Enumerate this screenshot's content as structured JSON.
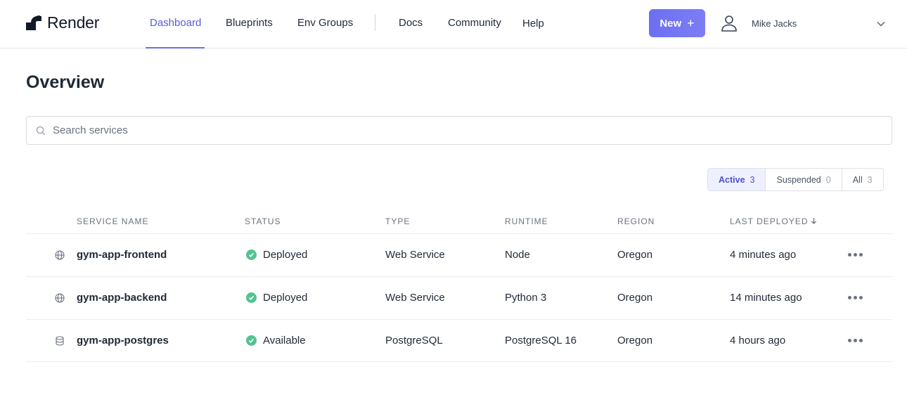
{
  "header": {
    "brand": "Render",
    "nav": [
      {
        "label": "Dashboard",
        "active": true
      },
      {
        "label": "Blueprints"
      },
      {
        "label": "Env Groups"
      },
      {
        "label": "Docs"
      },
      {
        "label": "Community"
      },
      {
        "label": "Help"
      }
    ],
    "new_button": "New",
    "new_button_icon": "plus-icon",
    "user_name": "Mike Jacks",
    "accent_color": "#5b5bd6"
  },
  "main": {
    "title": "Overview",
    "search": {
      "placeholder": "Search services",
      "value": ""
    },
    "filters": [
      {
        "label": "Active",
        "count": "3",
        "active": true
      },
      {
        "label": "Suspended",
        "count": "0"
      },
      {
        "label": "All",
        "count": "3"
      }
    ],
    "table": {
      "columns": [
        "SERVICE NAME",
        "STATUS",
        "TYPE",
        "RUNTIME",
        "REGION",
        "LAST DEPLOYED"
      ],
      "sort_icon": "arrow-down-icon",
      "rows": [
        {
          "icon": "globe-icon",
          "name": "gym-app-frontend",
          "status": "Deployed",
          "type": "Web Service",
          "runtime": "Node",
          "region": "Oregon",
          "last_deployed": "4 minutes ago"
        },
        {
          "icon": "globe-icon",
          "name": "gym-app-backend",
          "status": "Deployed",
          "type": "Web Service",
          "runtime": "Python 3",
          "region": "Oregon",
          "last_deployed": "14 minutes ago"
        },
        {
          "icon": "database-icon",
          "name": "gym-app-postgres",
          "status": "Available",
          "type": "PostgreSQL",
          "runtime": "PostgreSQL 16",
          "region": "Oregon",
          "last_deployed": "4 hours ago"
        }
      ],
      "status_color": "#53c394"
    }
  }
}
